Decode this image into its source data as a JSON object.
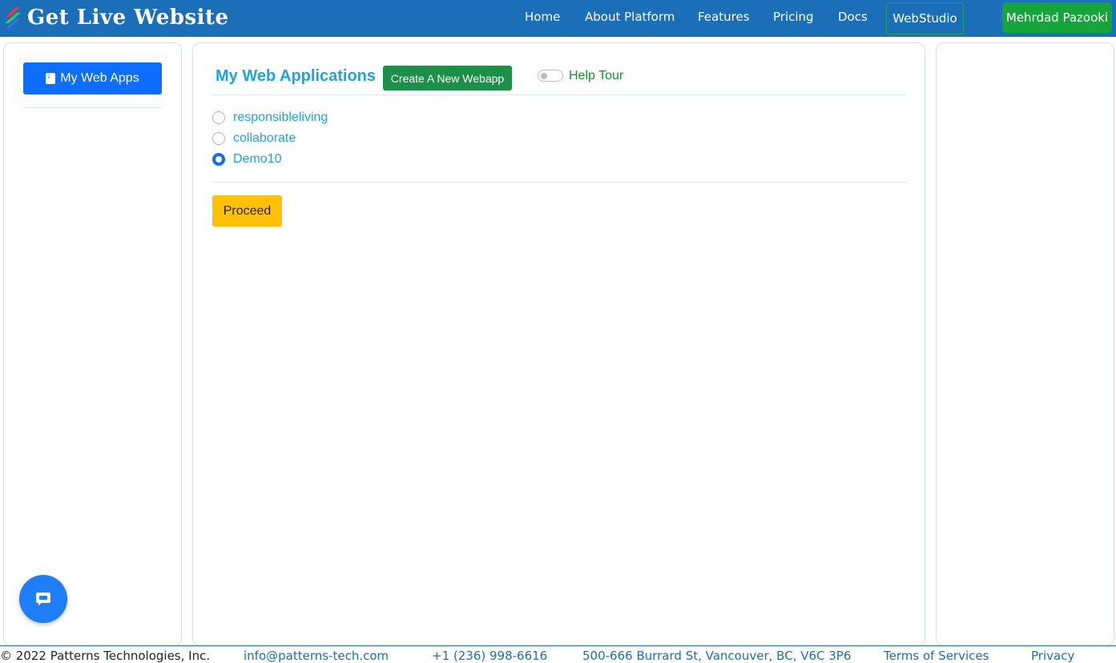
{
  "header": {
    "brand_title": "Get Live Website",
    "nav": {
      "home": "Home",
      "about": "About Platform",
      "features": "Features",
      "pricing": "Pricing",
      "docs": "Docs",
      "webstudio": "WebStudio"
    },
    "user_name": "Mehrdad Pazooki"
  },
  "sidebar": {
    "my_web_apps_label": "My Web Apps"
  },
  "main": {
    "title": "My Web Applications",
    "create_button_label": "Create A New Webapp",
    "help_tour_label": "Help Tour",
    "help_tour_enabled": false,
    "apps": [
      {
        "label": "responsibleliving",
        "selected": false
      },
      {
        "label": "collaborate",
        "selected": false
      },
      {
        "label": "Demo10",
        "selected": true
      }
    ],
    "proceed_label": "Proceed"
  },
  "footer": {
    "copyright": "© 2022 Patterns Technologies, Inc.",
    "email": "info@patterns-tech.com",
    "phone": "+1 (236) 998-6616",
    "address": "500-666 Burrard St, Vancouver, BC, V6C 3P6",
    "terms": "Terms of Services",
    "privacy": "Privacy"
  },
  "colors": {
    "nav_bg": "#1b6fb8",
    "primary": "#0d6efd",
    "title_blue": "#1ea3e4",
    "create_green": "#1c8f48",
    "user_green": "#16a53a",
    "proceed_yellow": "#ffc107",
    "help_green": "#1a8f2c"
  },
  "icons": {
    "logo": "tri-color-slash-logo",
    "sidebar_button": "download-file-icon",
    "chat": "chat-bubble-icon"
  }
}
